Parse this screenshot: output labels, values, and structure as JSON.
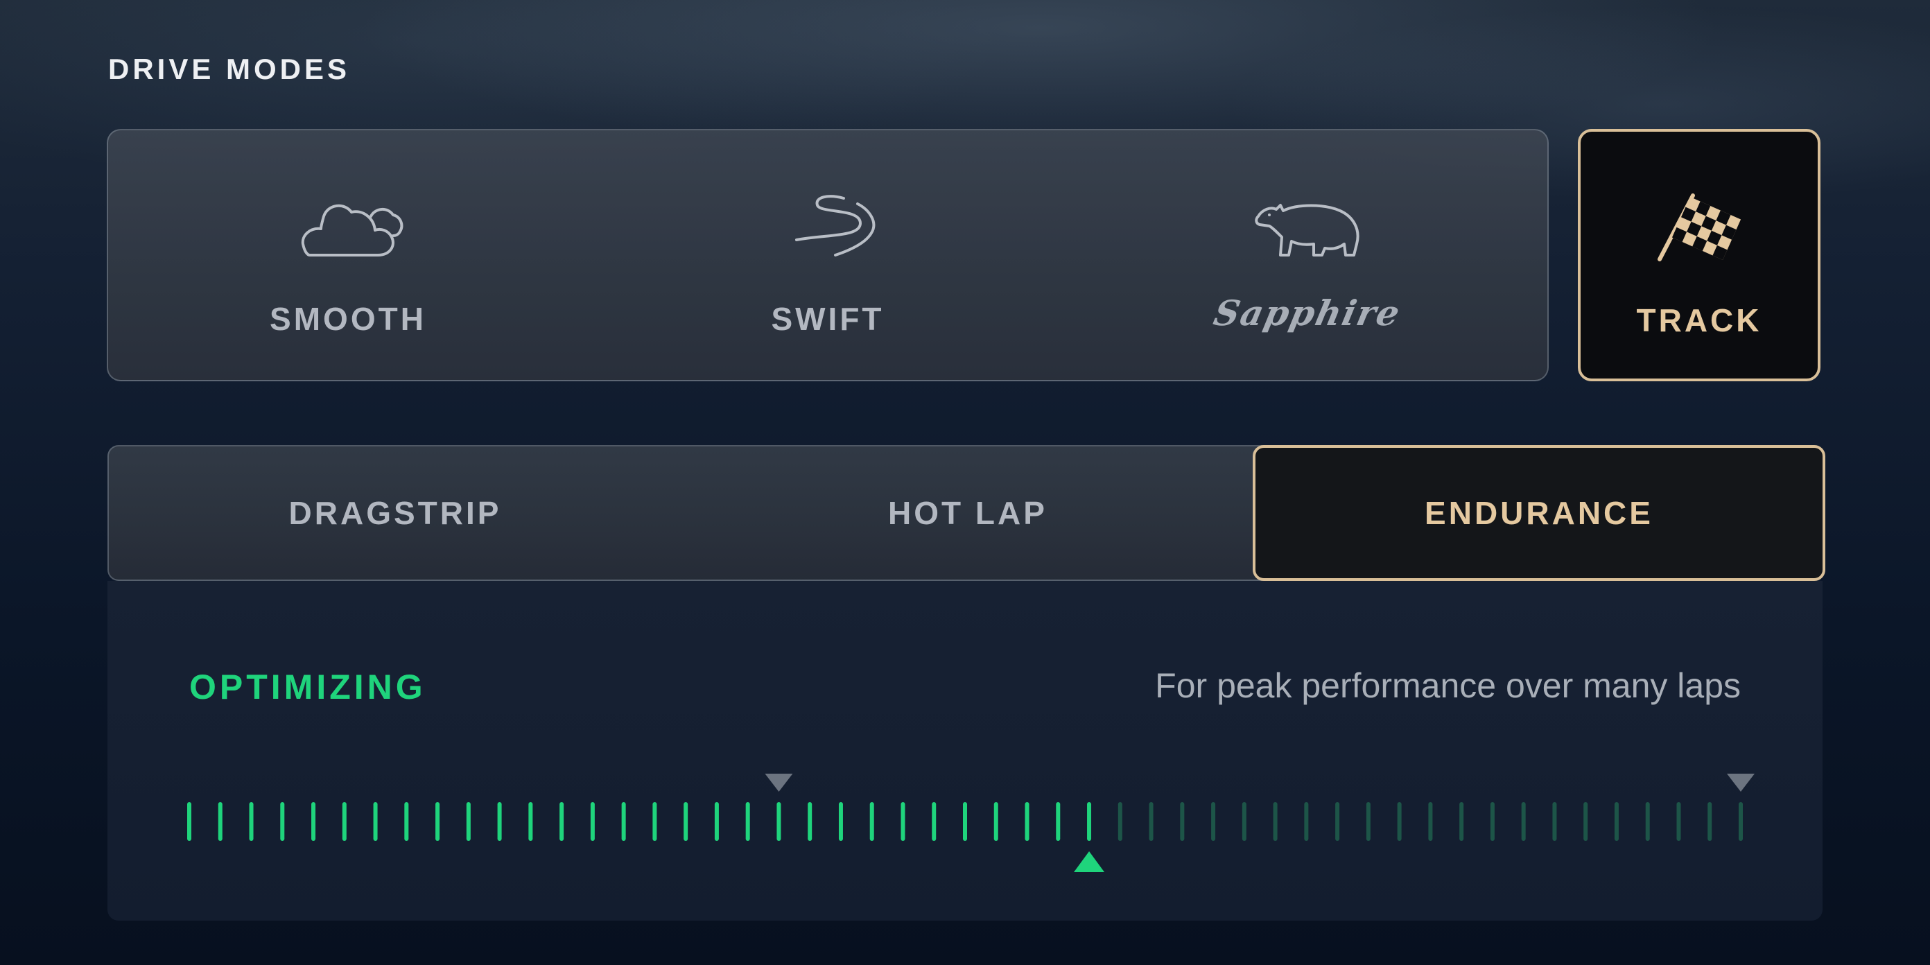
{
  "section_title": "DRIVE MODES",
  "modes": [
    {
      "label": "SMOOTH",
      "icon": "cloud-icon"
    },
    {
      "label": "SWIFT",
      "icon": "winding-road-icon"
    },
    {
      "label": "Sapphire",
      "icon": "bear-icon"
    }
  ],
  "track": {
    "label": "TRACK",
    "icon": "checkered-flag-icon",
    "selected": true
  },
  "subtabs": [
    {
      "label": "DRAGSTRIP",
      "selected": false
    },
    {
      "label": "HOT LAP",
      "selected": false
    },
    {
      "label": "ENDURANCE",
      "selected": true
    }
  ],
  "status": {
    "label": "OPTIMIZING",
    "description": "For peak performance over many laps"
  },
  "gauge": {
    "total_ticks": 51,
    "filled_ticks": 30,
    "marker_ticks": [
      19,
      50
    ],
    "pointer_tick": 29
  },
  "colors": {
    "accent_gold": "#d9bf98",
    "status_green": "#1fd47c",
    "tick_dim": "#1d5548"
  }
}
